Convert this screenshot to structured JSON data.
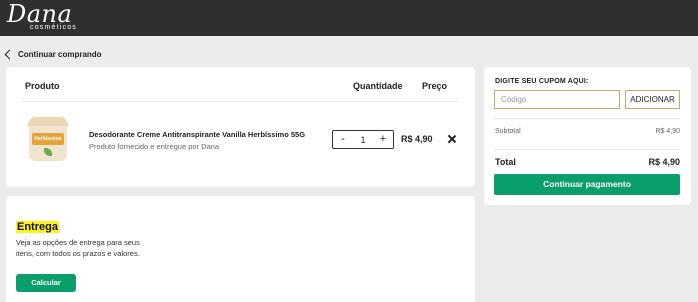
{
  "header": {
    "logo_main": "Dana",
    "logo_sub": "cosméticos"
  },
  "nav": {
    "back_label": "Continuar comprando"
  },
  "cart": {
    "columns": {
      "product": "Produto",
      "quantity": "Quantidade",
      "price": "Preço"
    },
    "items": [
      {
        "name": "Desodorante Creme Antitranspirante Vanilla Herbíssimo 55G",
        "seller": "Produto fornecido e entregue por Dana",
        "quantity": "1",
        "price": "R$ 4,90",
        "image_label": "Herbíssimo",
        "image_colors": {
          "lid": "#ead7b6",
          "body": "#f1e4cf",
          "label": "#e6a33c"
        }
      }
    ],
    "stepper": {
      "minus": "-",
      "plus": "+"
    }
  },
  "delivery": {
    "title": "Entrega",
    "description": "Veja as opções de entrega para seus itens, com todos os prazos e valores.",
    "button_label": "Calcular"
  },
  "summary": {
    "coupon_label": "DIGITE SEU CUPOM AQUI:",
    "coupon_placeholder": "Código",
    "coupon_button": "ADICIONAR",
    "subtotal_label": "Subtotal",
    "subtotal_value": "R$ 4,90",
    "total_label": "Total",
    "total_value": "R$ 4,90",
    "checkout_button": "Continuar pagamento"
  },
  "colors": {
    "header_bg": "#2f2f2f",
    "accent_green": "#0a9e6b",
    "highlight_yellow": "#fff21a",
    "coupon_border": "#c8a96a"
  }
}
